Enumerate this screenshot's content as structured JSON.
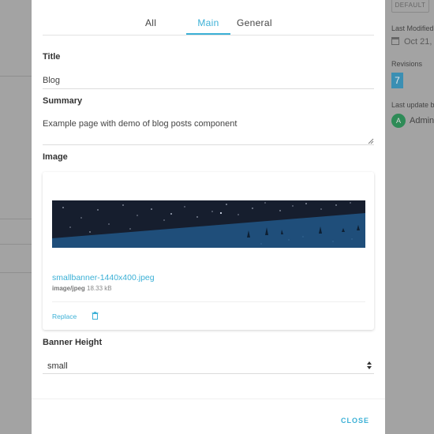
{
  "tabs": [
    {
      "label": "All",
      "active": false
    },
    {
      "label": "Main",
      "active": true
    },
    {
      "label": "General",
      "active": false
    }
  ],
  "fields": {
    "title_label": "Title",
    "title_value": "Blog",
    "summary_label": "Summary",
    "summary_value": "Example page with demo of blog posts component",
    "image_label": "Image",
    "banner_height_label": "Banner Height",
    "banner_height_value": "small"
  },
  "image": {
    "filename": "smallbanner-1440x400.jpeg",
    "mime": "image/jpeg",
    "size": "18.33 kB",
    "replace_label": "Replace"
  },
  "footer": {
    "close_label": "CLOSE"
  },
  "background_panel": {
    "badge": "DEFAULT",
    "last_modified_label": "Last Modified",
    "last_modified_value": "Oct 21,",
    "revisions_label": "Revisions",
    "revisions_count": "7",
    "last_update_label": "Last update b",
    "admin_initial": "A",
    "admin_name": "Admin"
  },
  "colors": {
    "accent": "#3bb0d6",
    "banner_sky": "#161e2e",
    "banner_ground": "#1f4e7a",
    "avatar": "#2e8b57"
  }
}
